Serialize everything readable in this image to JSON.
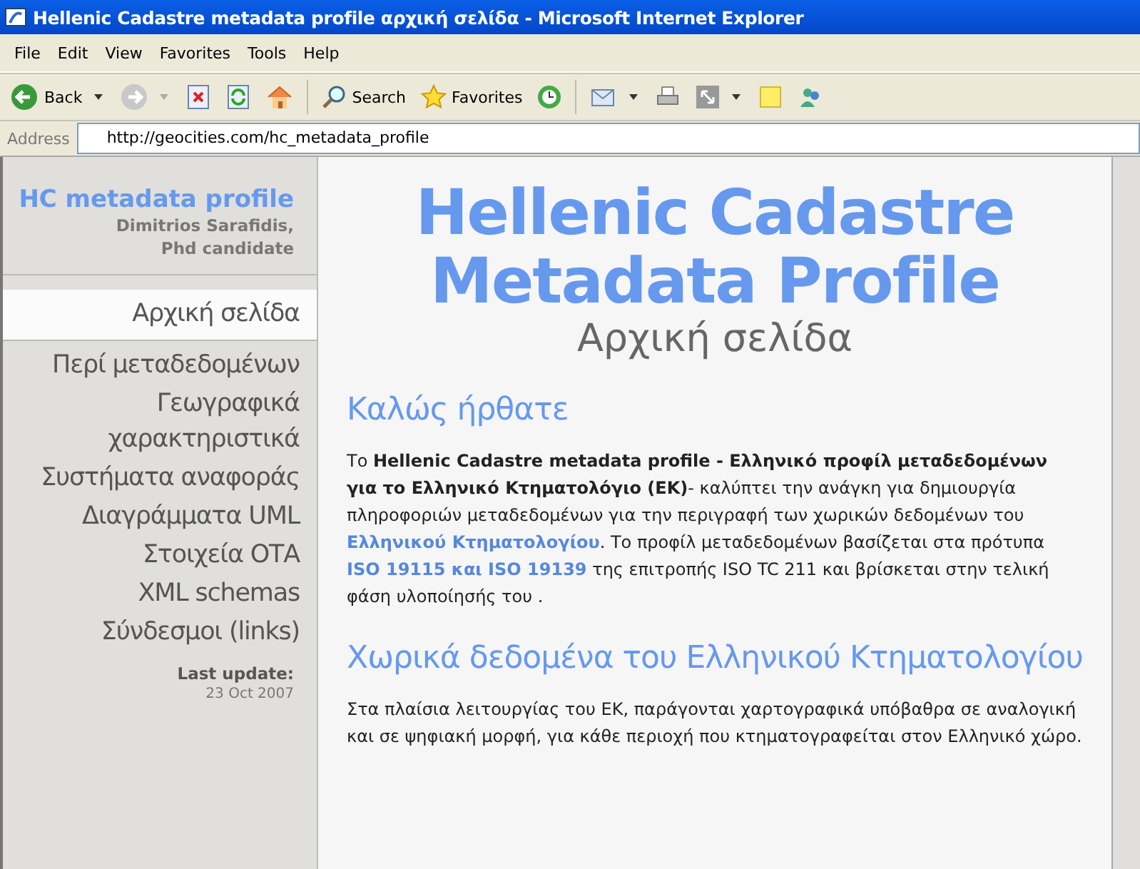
{
  "window": {
    "title": "Hellenic Cadastre metadata profile αρχική σελίδα - Microsoft Internet Explorer"
  },
  "menu": [
    "File",
    "Edit",
    "View",
    "Favorites",
    "Tools",
    "Help"
  ],
  "toolbar": {
    "back": "Back",
    "search": "Search",
    "favorites": "Favorites"
  },
  "address": {
    "label": "Address",
    "value": "http://geocities.com/hc_metadata_profile"
  },
  "sidebar": {
    "title": "HC metadata profile",
    "author": "Dimitrios Sarafidis, Phd candidate",
    "items": [
      {
        "label": "Αρχική σελίδα",
        "selected": true
      },
      {
        "label": "Περί μεταδεδομένων",
        "selected": false
      },
      {
        "label": "Γεωγραφικά χαρακτηριστικά",
        "selected": false
      },
      {
        "label": "Συστήματα αναφοράς",
        "selected": false
      },
      {
        "label": "Διαγράμματα UML",
        "selected": false
      },
      {
        "label": "Στοιχεία ΟΤΑ",
        "selected": false
      },
      {
        "label": "XML schemas",
        "selected": false
      },
      {
        "label": "Σύνδεσμοι (links)",
        "selected": false
      }
    ],
    "update_label": "Last update:",
    "update_date": "23 Oct 2007"
  },
  "main": {
    "title": "Hellenic Cadastre Metadata Profile",
    "subtitle": "Αρχική σελίδα",
    "sections": [
      {
        "heading": "Καλώς ήρθατε",
        "paragraph": [
          {
            "kind": "text",
            "text": "Το **Hellenic Cadastre metadata profile - Ελληνικό προφίλ μεταδεδομένων για το Ελληνικό Κτηματολόγιο (ΕΚ)**- καλύπτει την ανάγκη για δημιουργία πληροφοριών μεταδεδομένων για την περιγραφή των χωρικών δεδομένων του "
          },
          {
            "kind": "link",
            "text": "Ελληνικού Κτηματολογίου"
          },
          {
            "kind": "text",
            "text": ". Το προφίλ μεταδεδομένων βασίζεται στα πρότυπα "
          },
          {
            "kind": "link",
            "text": "ISO 19115 και ISO 19139"
          },
          {
            "kind": "text",
            "text": " της επιτροπής ISO TC 211 και βρίσκεται στην τελική φάση υλοποίησής του ."
          }
        ]
      },
      {
        "heading": "Χωρικά δεδομένα του Ελληνικού Κτηματολογίου",
        "paragraph": [
          {
            "kind": "text",
            "text": "Στα πλαίσια λειτουργίας του ΕΚ, παράγονται χαρτογραφικά υπόβαθρα σε αναλογική και σε ψηφιακή μορφή, για κάθε περιοχή που κτηματογραφείται στον Ελληνικό χώρο."
          }
        ]
      }
    ]
  }
}
